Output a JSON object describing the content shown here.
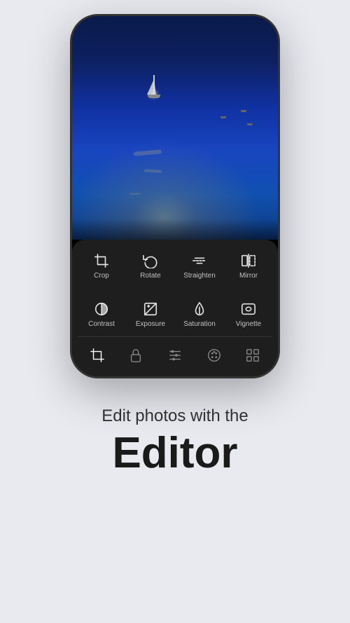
{
  "phone": {
    "tools_row1": [
      {
        "id": "crop",
        "label": "Crop"
      },
      {
        "id": "rotate",
        "label": "Rotate"
      },
      {
        "id": "straighten",
        "label": "Straighten"
      },
      {
        "id": "mirror",
        "label": "Mirror"
      }
    ],
    "tools_row2": [
      {
        "id": "contrast",
        "label": "Contrast"
      },
      {
        "id": "exposure",
        "label": "Exposure"
      },
      {
        "id": "saturation",
        "label": "Saturation"
      },
      {
        "id": "vignette",
        "label": "Vignette"
      }
    ],
    "nav_items": [
      "crop-nav",
      "lock-nav",
      "sliders-nav",
      "palette-nav",
      "grid-nav"
    ]
  },
  "page": {
    "subtitle": "Edit photos with the",
    "title": "Editor"
  }
}
